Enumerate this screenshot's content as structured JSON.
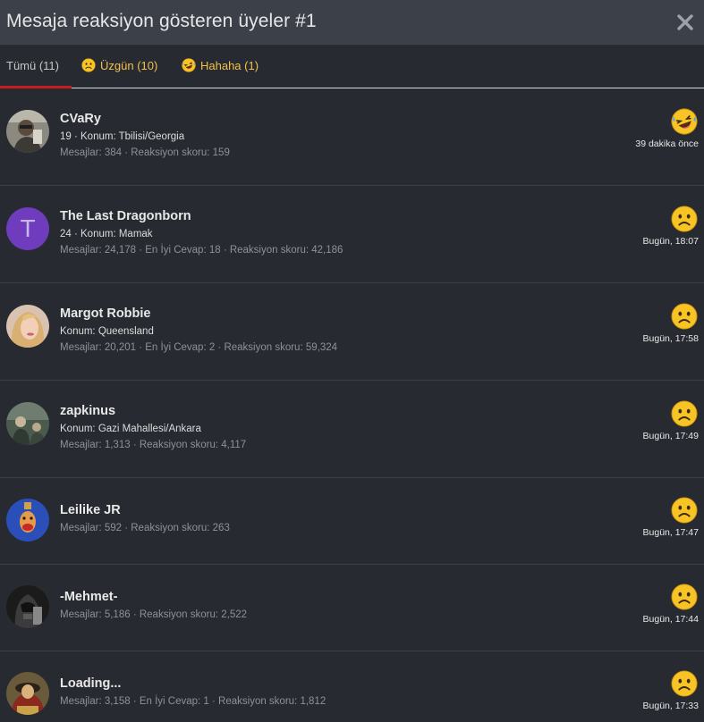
{
  "dialog": {
    "title": "Mesaja reaksiyon gösteren üyeler #1"
  },
  "tabs": {
    "all": "Tümü (11)",
    "sad": "Üzgün (10)",
    "haha": "Hahaha (1)"
  },
  "members": [
    {
      "name": "CVaRy",
      "meta": "19 · Konum: Tbilisi/Georgia",
      "stats": "Mesajlar: 384 · Reaksiyon skoru: 159",
      "reaction": "haha-emoji-icon",
      "time": "39 dakika önce"
    },
    {
      "name": "The Last Dragonborn",
      "avatar_letter": "T",
      "meta": "24 · Konum: Mamak",
      "stats": "Mesajlar: 24,178 · En İyi Cevap: 18 · Reaksiyon skoru: 42,186",
      "reaction": "sad-emoji-icon",
      "time": "Bugün, 18:07"
    },
    {
      "name": "Margot Robbie",
      "meta": "Konum: Queensland",
      "stats": "Mesajlar: 20,201 · En İyi Cevap: 2 · Reaksiyon skoru: 59,324",
      "reaction": "sad-emoji-icon",
      "time": "Bugün, 17:58"
    },
    {
      "name": "zapkinus",
      "meta": "Konum: Gazi Mahallesi/Ankara",
      "stats": "Mesajlar: 1,313 · Reaksiyon skoru: 4,117",
      "reaction": "sad-emoji-icon",
      "time": "Bugün, 17:49"
    },
    {
      "name": "Leilike JR",
      "stats": "Mesajlar: 592 · Reaksiyon skoru: 263",
      "reaction": "sad-emoji-icon",
      "time": "Bugün, 17:47"
    },
    {
      "name": "-Mehmet-",
      "stats": "Mesajlar: 5,186 · Reaksiyon skoru: 2,522",
      "reaction": "sad-emoji-icon",
      "time": "Bugün, 17:44"
    },
    {
      "name": "Loading...",
      "stats": "Mesajlar: 3,158 · En İyi Cevap: 1 · Reaksiyon skoru: 1,812",
      "reaction": "sad-emoji-icon",
      "time": "Bugün, 17:33"
    }
  ],
  "colors": {
    "background": "#272a30",
    "title_bar": "#3c4049",
    "tab_active_underline": "#c41d1d",
    "tab_reaction_text": "#f3c14a",
    "emoji_yellow": "#f7c325",
    "avatar_letter_bg": "#6e3cbc"
  }
}
